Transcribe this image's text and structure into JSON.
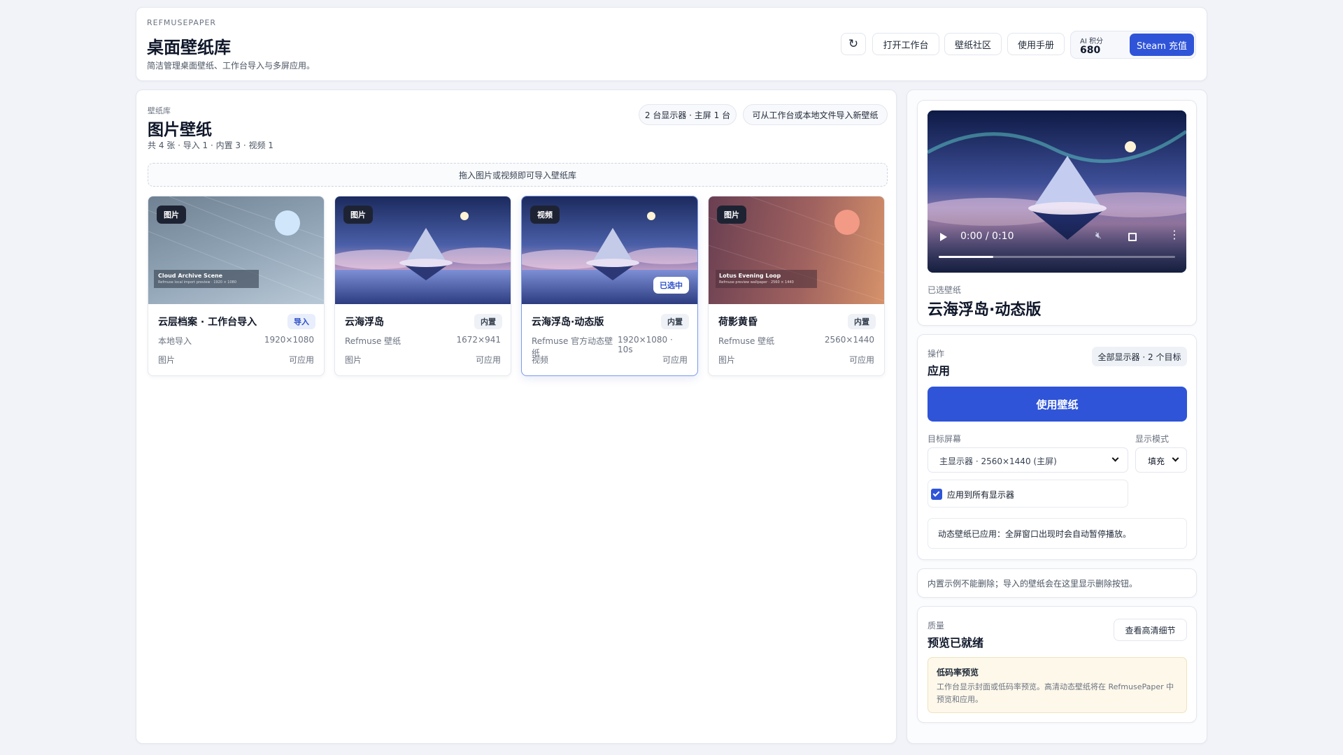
{
  "header": {
    "brand": "REFMUSEPAPER",
    "title": "桌面壁纸库",
    "subtitle": "简洁管理桌面壁纸、工作台导入与多屏应用。",
    "refresh_icon": "↻",
    "buttons": {
      "open_workbench": "打开工作台",
      "community": "壁纸社区",
      "manual": "使用手册"
    },
    "ai_points": {
      "label": "AI 积分",
      "value": "680"
    },
    "steam_button": "Steam 充值"
  },
  "library": {
    "eyebrow": "壁纸库",
    "title": "图片壁纸",
    "stats": "共 4 张 · 导入 1 · 内置 3 · 视频 1",
    "display_pill": "2 台显示器 · 主屏 1 台",
    "import_pill": "可从工作台或本地文件导入新壁纸",
    "dropzone": "拖入图片或视频即可导入壁纸库",
    "items": [
      {
        "badge": "图片",
        "title": "云层档案 · 工作台导入",
        "tag": "导入",
        "source": "本地导入",
        "resolution": "1920×1080",
        "kind": "图片",
        "status": "可应用",
        "thumb_caption": "Cloud Archive Scene",
        "thumb_sub": "Refmuse local import preview · 1920 × 1080"
      },
      {
        "badge": "图片",
        "title": "云海浮岛",
        "tag": "内置",
        "source": "Refmuse 壁纸",
        "resolution": "1672×941",
        "kind": "图片",
        "status": "可应用"
      },
      {
        "badge": "视频",
        "title": "云海浮岛·动态版",
        "tag": "内置",
        "source": "Refmuse 官方动态壁纸",
        "resolution": "1920×1080 · 10s",
        "kind": "视频",
        "status": "可应用",
        "selected_badge": "已选中"
      },
      {
        "badge": "图片",
        "title": "荷影黄昏",
        "tag": "内置",
        "source": "Refmuse 壁纸",
        "resolution": "2560×1440",
        "kind": "图片",
        "status": "可应用",
        "thumb_caption": "Lotus Evening Loop",
        "thumb_sub": "Refmuse preview wallpaper · 2560 × 1440"
      }
    ]
  },
  "preview": {
    "time": "0:00 / 0:10",
    "progress": 0.23,
    "selected_label": "已选壁纸",
    "selected_title": "云海浮岛·动态版"
  },
  "actions": {
    "eyebrow": "操作",
    "title": "应用",
    "target_pill": "全部显示器 · 2 个目标",
    "apply_button": "使用壁纸",
    "screen_label": "目标屏幕",
    "screen_value": "主显示器 · 2560×1440 (主屏)",
    "mode_label": "显示模式",
    "mode_value": "填充",
    "apply_all_label": "应用到所有显示器",
    "apply_all_checked": true,
    "notice": "动态壁纸已应用：全屏窗口出现时会自动暂停播放。"
  },
  "delete_note": "内置示例不能删除；导入的壁纸会在这里显示删除按钮。",
  "quality": {
    "eyebrow": "质量",
    "title": "预览已就绪",
    "button": "查看高清细节",
    "alert_title": "低码率预览",
    "alert_body": "工作台显示封面或低码率预览。高清动态壁纸将在 RefmusePaper 中预览和应用。"
  },
  "colors": {
    "accent": "#2f54d8",
    "selected_border": "#7c9ae8",
    "alert_bg": "#fdf8ea"
  }
}
